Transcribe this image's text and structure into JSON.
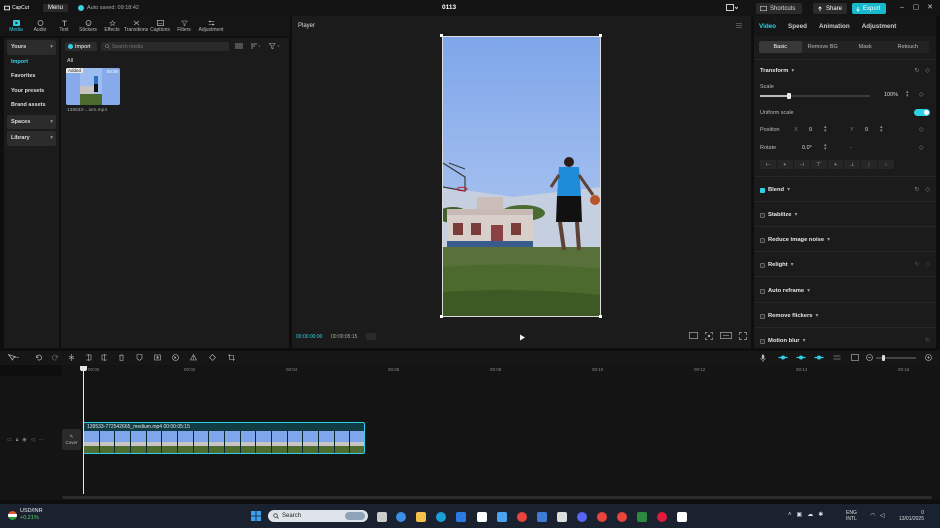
{
  "app": {
    "name": "CapCut",
    "menu_label": "Menu",
    "autosave": "Auto saved: 09:18:42",
    "project_title": "0113"
  },
  "header_buttons": {
    "shortcuts": "Shortcuts",
    "share": "Share",
    "export": "Export"
  },
  "media_tools": [
    {
      "label": "Media",
      "icon": "media-icon",
      "active": true
    },
    {
      "label": "Audio",
      "icon": "audio-icon"
    },
    {
      "label": "Text",
      "icon": "text-icon"
    },
    {
      "label": "Stickers",
      "icon": "stickers-icon"
    },
    {
      "label": "Effects",
      "icon": "effects-icon"
    },
    {
      "label": "Transitions",
      "icon": "transitions-icon"
    },
    {
      "label": "Captions",
      "icon": "captions-icon"
    },
    {
      "label": "Filters",
      "icon": "filters-icon"
    },
    {
      "label": "Adjustment",
      "icon": "adjustment-icon"
    }
  ],
  "left_nav": {
    "yours": "Yours",
    "items": [
      "Import",
      "Favorites",
      "Your presets",
      "Brand assets"
    ],
    "spaces": "Spaces",
    "library": "Library"
  },
  "media_panel": {
    "import_label": "Import",
    "search_placeholder": "Search media",
    "filter_all": "All",
    "thumb_badge": "Added",
    "thumb_duration": "00:06",
    "thumb_name": "139533-...ium.mp4"
  },
  "player": {
    "title": "Player",
    "current_time": "00:00:00:00",
    "total_time": "00:00:05:15"
  },
  "properties": {
    "tabs": [
      "Video",
      "Speed",
      "Animation",
      "Adjustment"
    ],
    "subtabs": [
      "Basic",
      "Remove BG",
      "Mask",
      "Retouch"
    ],
    "transform": "Transform",
    "scale_label": "Scale",
    "scale_value": "100%",
    "scale_fraction": 0.26,
    "uniform_scale": "Uniform scale",
    "position_label": "Position",
    "pos_x_label": "X",
    "pos_x": "0",
    "pos_y_label": "Y",
    "pos_y": "0",
    "rotate_label": "Rotate",
    "rotate_value": "0.0°",
    "rotate_sep": "-",
    "sections": [
      "Blend",
      "Stabilize",
      "Reduce image noise",
      "Relight",
      "Auto reframe",
      "Remove flickers",
      "Motion blur"
    ]
  },
  "timeline": {
    "ticks": [
      "00:00",
      "00:02",
      "00:04",
      "00:06",
      "00:08",
      "00:10",
      "00:12",
      "00:14",
      "00:16"
    ],
    "cover_label": "Cover",
    "clip_label": "139533-772542665_medium.mp4  00:00:05:15"
  },
  "taskbar": {
    "ticker_name": "USD/INR",
    "ticker_change": "+0.21%",
    "search_label": "Search",
    "lang_line1": "ENG",
    "lang_line2": "INTL",
    "clock_time": "0",
    "clock_date": "13/01/2025"
  },
  "colors": {
    "accent": "#2fd0e6",
    "export": "#18b8cc",
    "panel": "#1b1b1b"
  }
}
